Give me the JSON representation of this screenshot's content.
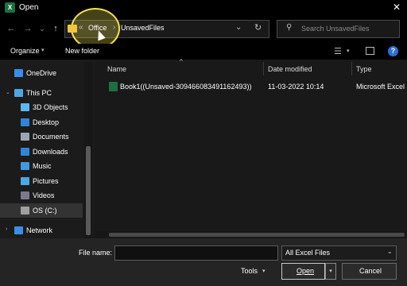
{
  "window": {
    "title": "Open",
    "app_icon_letter": "X",
    "close": "✕"
  },
  "nav": {
    "back": "←",
    "forward": "→",
    "down": "⌄",
    "up": "↑"
  },
  "address": {
    "crumbs": [
      "Office",
      "UnsavedFiles"
    ],
    "overflow": "«",
    "separator": "›",
    "dropdown": "⌄",
    "refresh": "↻"
  },
  "search": {
    "placeholder": "Search UnsavedFiles",
    "icon": "search-icon"
  },
  "toolbar": {
    "organize": "Organize",
    "organize_drop": "▾",
    "new_folder": "New folder",
    "view_drop": "▾",
    "help": "?"
  },
  "sidebar": {
    "items": [
      {
        "label": "OneDrive",
        "color": "#3a8ee6",
        "chev": ""
      },
      {
        "label": "This PC",
        "color": "#4aa8e8",
        "chev": "⌄"
      },
      {
        "label": "3D Objects",
        "color": "#5ab8f0",
        "chev": ""
      },
      {
        "label": "Desktop",
        "color": "#2f86d6",
        "chev": ""
      },
      {
        "label": "Documents",
        "color": "#9aa6b4",
        "chev": ""
      },
      {
        "label": "Downloads",
        "color": "#2f86d6",
        "chev": ""
      },
      {
        "label": "Music",
        "color": "#3f9ae0",
        "chev": ""
      },
      {
        "label": "Pictures",
        "color": "#4aa8e8",
        "chev": ""
      },
      {
        "label": "Videos",
        "color": "#7a7a8a",
        "chev": ""
      },
      {
        "label": "OS (C:)",
        "color": "#a0a0a0",
        "chev": ""
      },
      {
        "label": "Network",
        "color": "#3a8ee6",
        "chev": "›"
      }
    ]
  },
  "columns": {
    "name": "Name",
    "date": "Date modified",
    "type": "Type",
    "sort": "^"
  },
  "files": [
    {
      "name": "Book1((Unsaved-309466083491162493))",
      "date": "11-03-2022 10:14",
      "type": "Microsoft Excel"
    }
  ],
  "bottom": {
    "filename_label": "File name:",
    "filename_value": "",
    "filetype": "All Excel Files",
    "filetype_drop": "⌄",
    "tools": "Tools",
    "tools_drop": "▾",
    "open": "Open",
    "open_drop": "▾",
    "cancel": "Cancel"
  },
  "colors": {
    "accent_highlight": "#f5e04a",
    "excel_green": "#1d6f42",
    "help_blue": "#2c6fd8"
  }
}
